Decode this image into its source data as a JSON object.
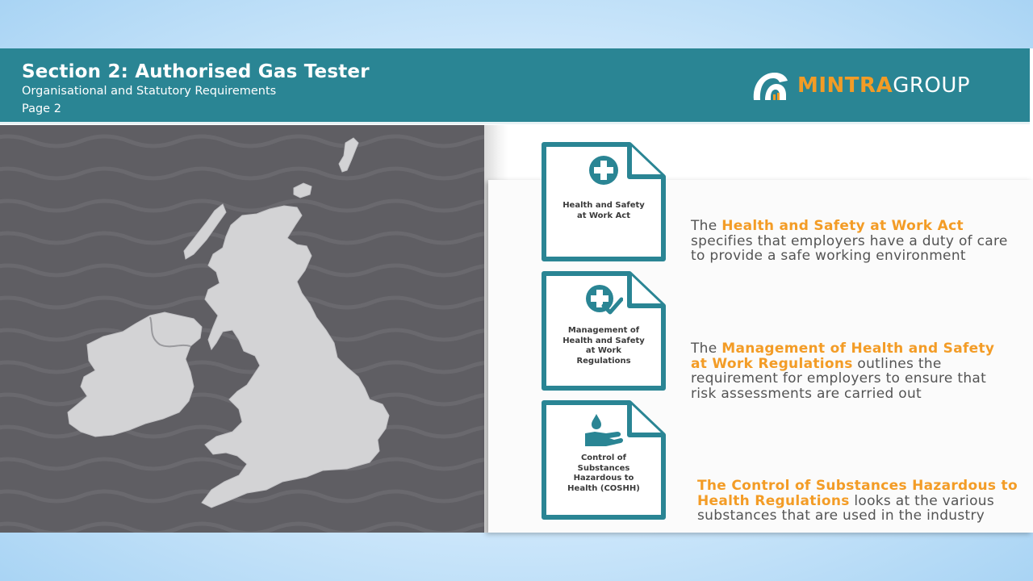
{
  "header": {
    "title": "Section 2: Authorised Gas Tester",
    "subtitle": "Organisational and Statutory Requirements",
    "page": "Page 2"
  },
  "logo": {
    "icon": "mintra-logo-icon",
    "part1": "MINTRA",
    "part2": "GROUP",
    "colors": {
      "accent": "#f39c26",
      "white": "#ffffff"
    }
  },
  "map": {
    "icon": "uk-map-icon"
  },
  "items": [
    {
      "icon": "first-aid-cross-icon",
      "doc_label": "Health and Safety at Work Act",
      "desc_pre": "The ",
      "desc_highlight": "Health and Safety at Work Act",
      "desc_post": " specifies that employers have a duty of care to provide a safe working environment"
    },
    {
      "icon": "cross-check-icon",
      "doc_label": "Management of Health and Safety at Work Regulations",
      "desc_pre": "The ",
      "desc_highlight": "Management of Health and Safety at Work Regulations",
      "desc_post": " outlines the requirement for employers to ensure that risk assessments are carried out"
    },
    {
      "icon": "hand-droplet-icon",
      "doc_label": "Control of Substances Hazardous to Health (COSHH)",
      "desc_pre": "",
      "desc_highlight": "The Control of Substances Hazardous to Health Regulations",
      "desc_post": " looks at the various substances that are used in the industry"
    }
  ],
  "colors": {
    "teal": "#2a8594",
    "orange": "#f39c26",
    "map_bg": "#5f5e63",
    "land": "#d3d3d5"
  }
}
